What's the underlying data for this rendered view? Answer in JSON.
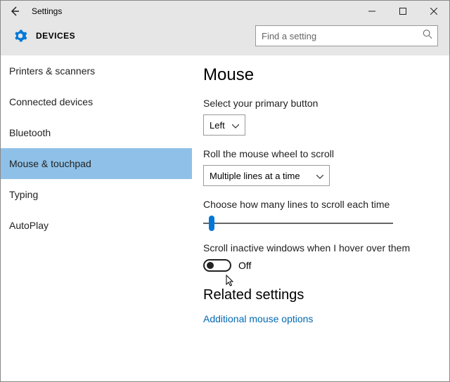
{
  "window": {
    "title": "Settings",
    "section_label": "DEVICES"
  },
  "search": {
    "placeholder": "Find a setting"
  },
  "sidebar": {
    "items": [
      {
        "label": "Printers & scanners"
      },
      {
        "label": "Connected devices"
      },
      {
        "label": "Bluetooth"
      },
      {
        "label": "Mouse & touchpad"
      },
      {
        "label": "Typing"
      },
      {
        "label": "AutoPlay"
      }
    ],
    "active_index": 3
  },
  "main": {
    "heading": "Mouse",
    "primary_button_label": "Select your primary button",
    "primary_button_value": "Left",
    "wheel_label": "Roll the mouse wheel to scroll",
    "wheel_value": "Multiple lines at a time",
    "lines_label": "Choose how many lines to scroll each time",
    "hover_label": "Scroll inactive windows when I hover over them",
    "hover_state": "Off",
    "related_heading": "Related settings",
    "related_link": "Additional mouse options"
  }
}
